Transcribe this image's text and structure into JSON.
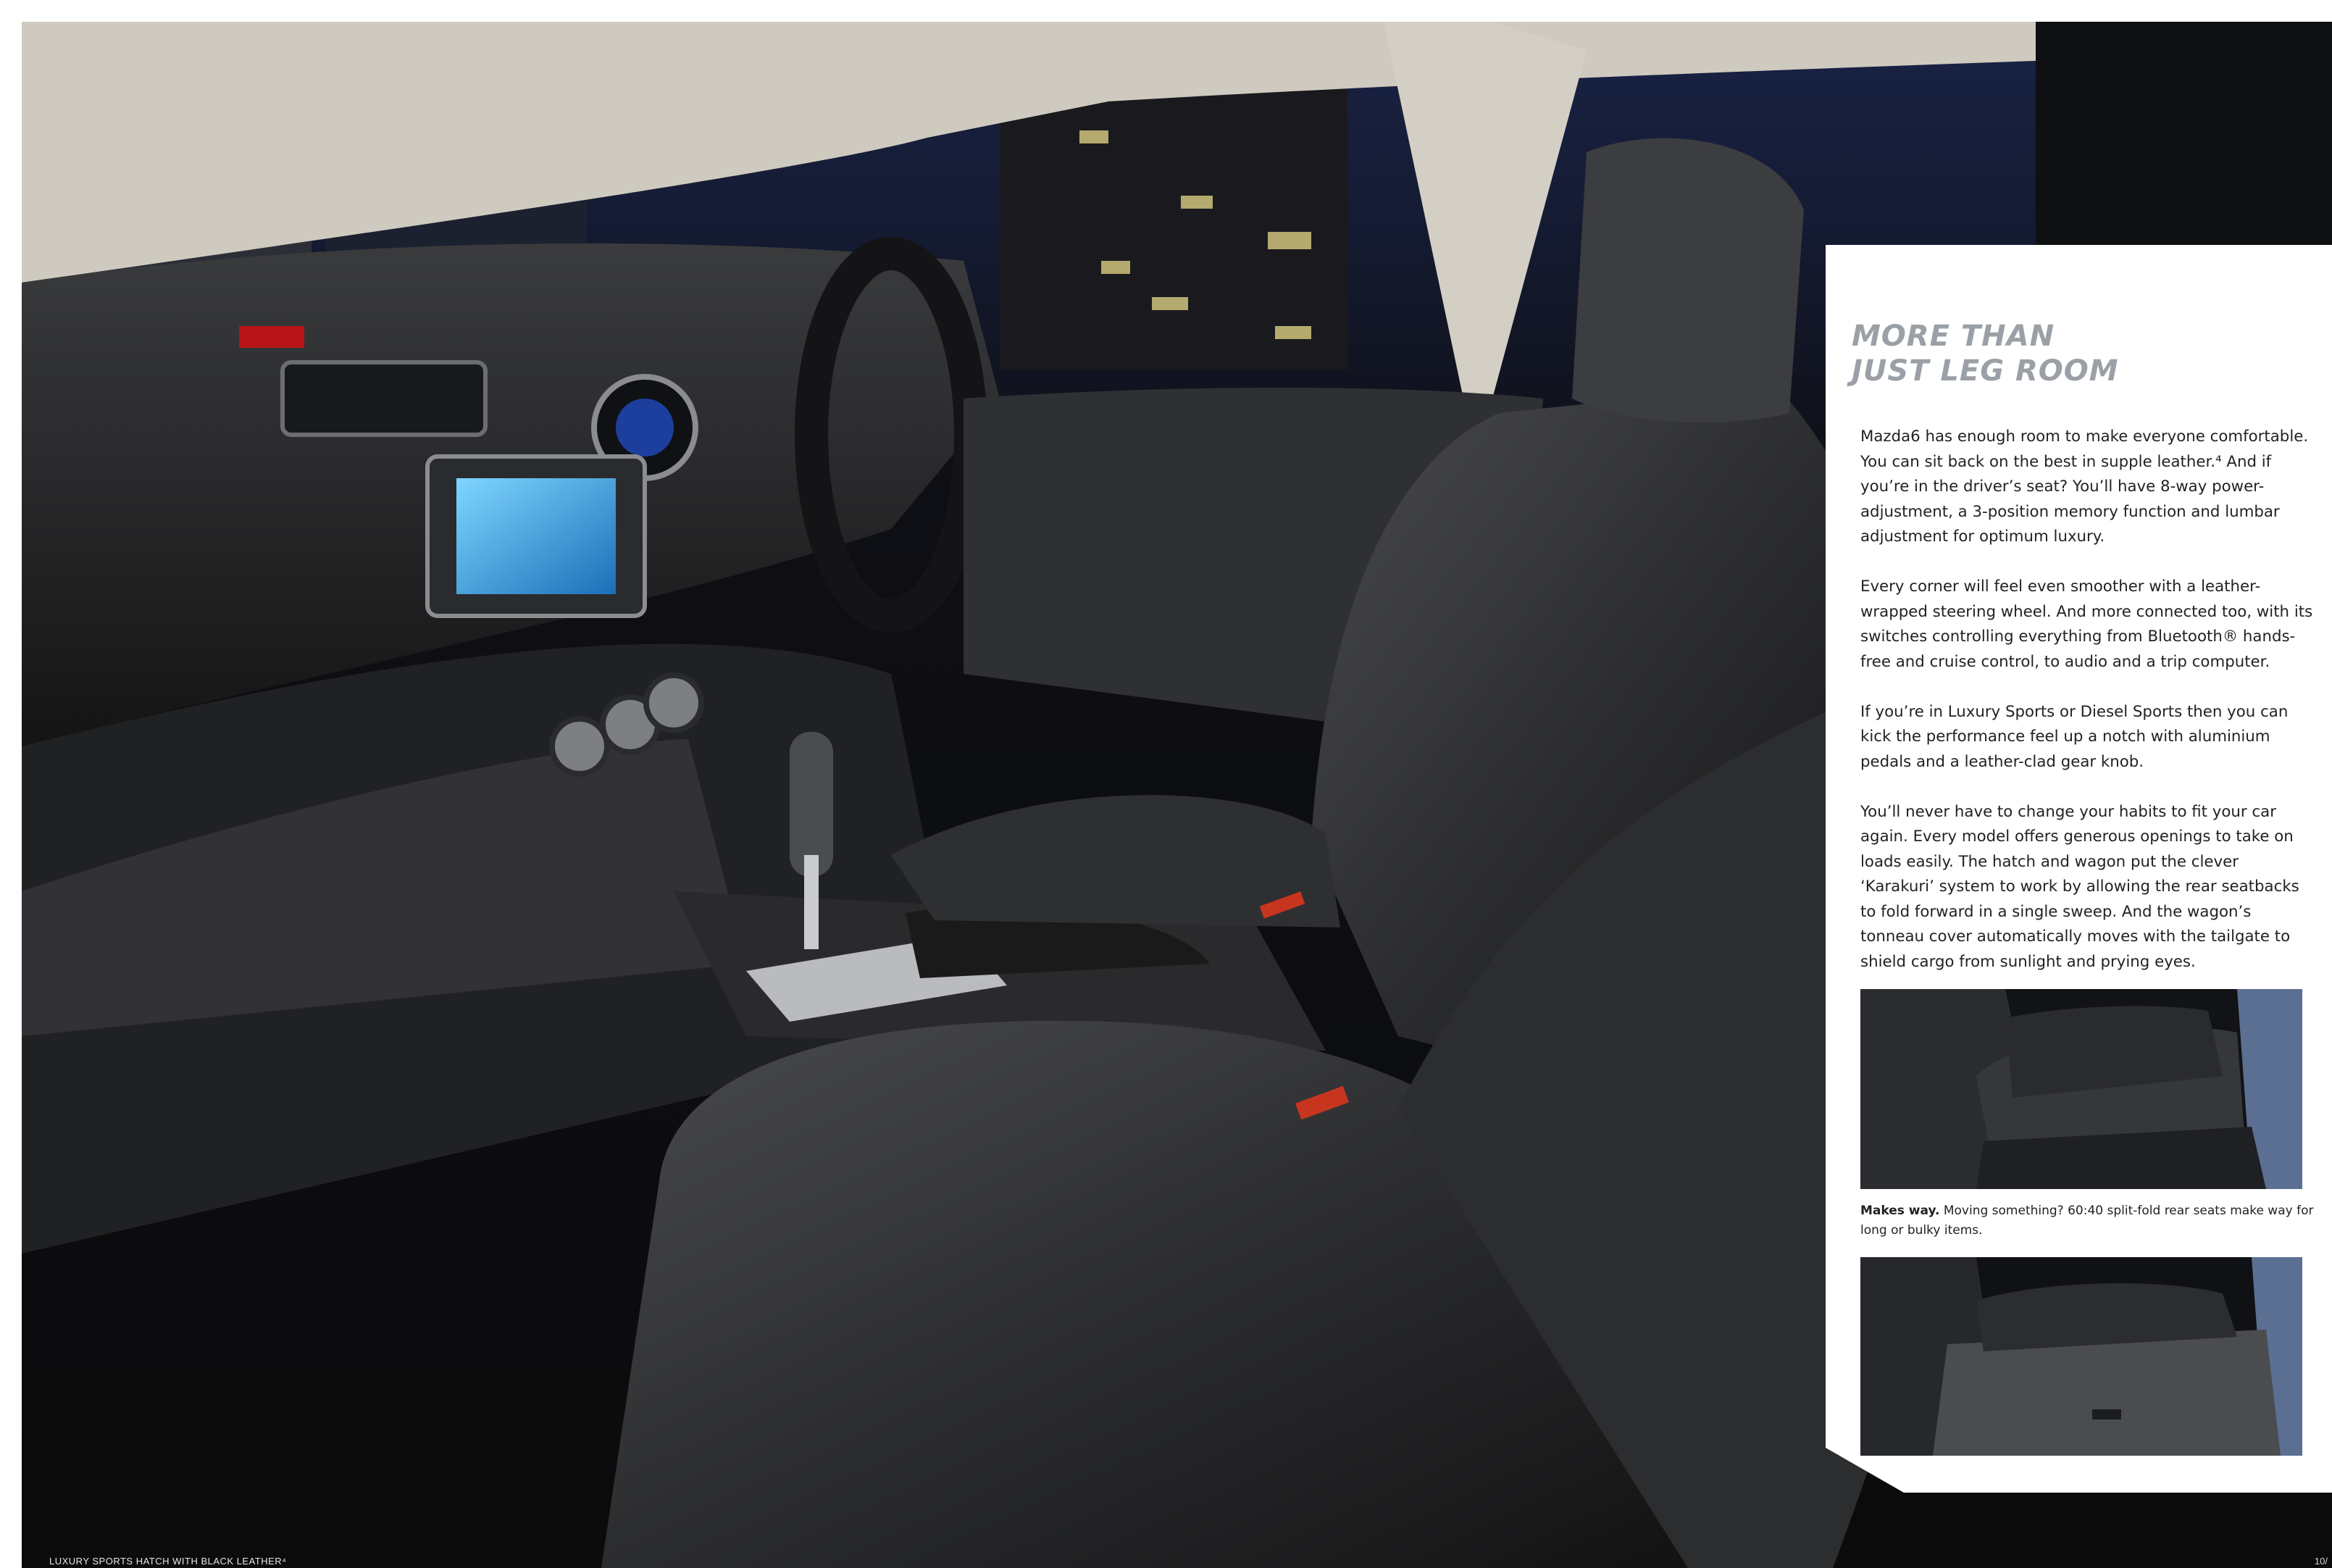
{
  "page": {
    "heading_line1": "MORE THAN",
    "heading_line2": "JUST LEG ROOM",
    "paragraphs": [
      "Mazda6 has enough room to make everyone comfortable. You can sit back on the best in supple leather.⁴ And if you’re in the driver’s seat? You’ll have 8-way power-adjustment, a 3-position memory function and lumbar adjustment for optimum luxury.",
      "Every corner will feel even smoother with a leather-wrapped steering wheel. And more connected too, with its switches controlling everything from Bluetooth® hands-free and cruise control, to audio and a trip computer.",
      "If you’re in Luxury Sports or Diesel Sports then you can kick the performance feel up a notch with aluminium pedals and a leather-clad gear knob.",
      "You’ll never have to change your habits to fit your car again. Every model offers generous openings to take on loads easily. The hatch and wagon put the clever ‘Karakuri’ system to work by allowing the rear seatbacks to fold forward in a single sweep. And the wagon’s tonneau cover automatically moves with the tailgate to shield cargo from sunlight and prying eyes."
    ],
    "photo_caption_bold": "Makes way.",
    "photo_caption_text": " Moving something? 60:40 split-fold rear seats make way for long or bulky items.",
    "image_caption": "LUXURY SPORTS HATCH WITH BLACK LEATHER⁴",
    "page_number": "10/"
  },
  "colors": {
    "heading": "#9aa0a6",
    "body": "#222222",
    "leather": "#2a2b2d",
    "night_sky": "#1a2347"
  }
}
